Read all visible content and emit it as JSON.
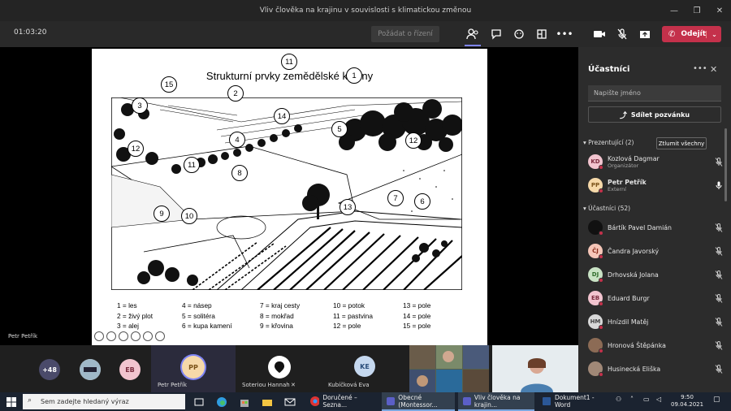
{
  "window": {
    "title": "Vliv člověka na krajinu v souvislosti s klimatickou změnou"
  },
  "toolbar": {
    "timer": "01:03:20",
    "raise_request": "Požádat o řízení",
    "leave": "Odejít"
  },
  "slide": {
    "title": "Strukturní prvky zemědělské krajiny",
    "map_numbers": [
      "1",
      "2",
      "3",
      "4",
      "5",
      "6",
      "7",
      "8",
      "9",
      "10",
      "11",
      "11",
      "12",
      "12",
      "13",
      "14",
      "15"
    ],
    "legend": [
      [
        "1 = les",
        "2 = živý plot",
        "3 = alej"
      ],
      [
        "4 = násep",
        "5 = solitéra",
        "6 = kupa kamení"
      ],
      [
        "7 = kraj cesty",
        "8 = mokřad",
        "9 = křovina"
      ],
      [
        "10 = potok",
        "11 = pastvina",
        "12 = pole"
      ],
      [
        "13 = pole",
        "14 = pole",
        "15 = pole"
      ]
    ]
  },
  "stage": {
    "presenter_label": "Petr Petřík"
  },
  "panel": {
    "title": "Účastníci",
    "search_placeholder": "Napište jméno",
    "share_invite": "Sdílet pozvánku",
    "presenters_header": "Prezentující (2)",
    "mute_all": "Ztlumit všechny",
    "attendees_header": "Účastníci (52)",
    "presenters": [
      {
        "initials": "KD",
        "name": "Kozlová Dagmar",
        "role": "Organizátor",
        "color": "#f2c4cf",
        "text": "#7a2a3d",
        "mic": "muted"
      },
      {
        "initials": "PP",
        "name": "Petr Petřík",
        "role": "Externí",
        "color": "#f6d9a9",
        "text": "#7a5218",
        "mic": "on"
      }
    ],
    "attendees": [
      {
        "initials": "",
        "name": "Bártík Pavel Damián",
        "color": "#111",
        "text": "#fff"
      },
      {
        "initials": "ČJ",
        "name": "Čandra Javorský",
        "color": "#f5c6b8",
        "text": "#8a2e1c"
      },
      {
        "initials": "DJ",
        "name": "Drhovská Jolana",
        "color": "#c9e3c5",
        "text": "#2e6b2a"
      },
      {
        "initials": "EB",
        "name": "Eduard Burgr",
        "color": "#f2c4cf",
        "text": "#7a2a3d"
      },
      {
        "initials": "HM",
        "name": "Hnízdil Matěj",
        "color": "#d8d8d8",
        "text": "#444"
      },
      {
        "initials": "",
        "name": "Hronová Štěpánka",
        "color": "#8c6b55",
        "text": "#fff"
      },
      {
        "initials": "",
        "name": "Husinecká Eliška",
        "color": "#a08877",
        "text": "#fff"
      }
    ]
  },
  "video_strip": {
    "more_count": "+48",
    "tiles": [
      {
        "initials": "EB",
        "name": ""
      },
      {
        "initials": "PP",
        "name": "Petr Petřík"
      },
      {
        "initials": "",
        "name": "Soteriou Hannah"
      },
      {
        "initials": "KE",
        "name": "Kubíčková Eva"
      }
    ]
  },
  "taskbar": {
    "search": "Sem zadejte hledaný výraz",
    "apps": [
      "Doručené – Sezna...",
      "Obecné (Montessor...",
      "Vliv člověka na krajin...",
      "Dokument1 - Word"
    ],
    "time": "9:50",
    "date": "09.04.2021"
  }
}
